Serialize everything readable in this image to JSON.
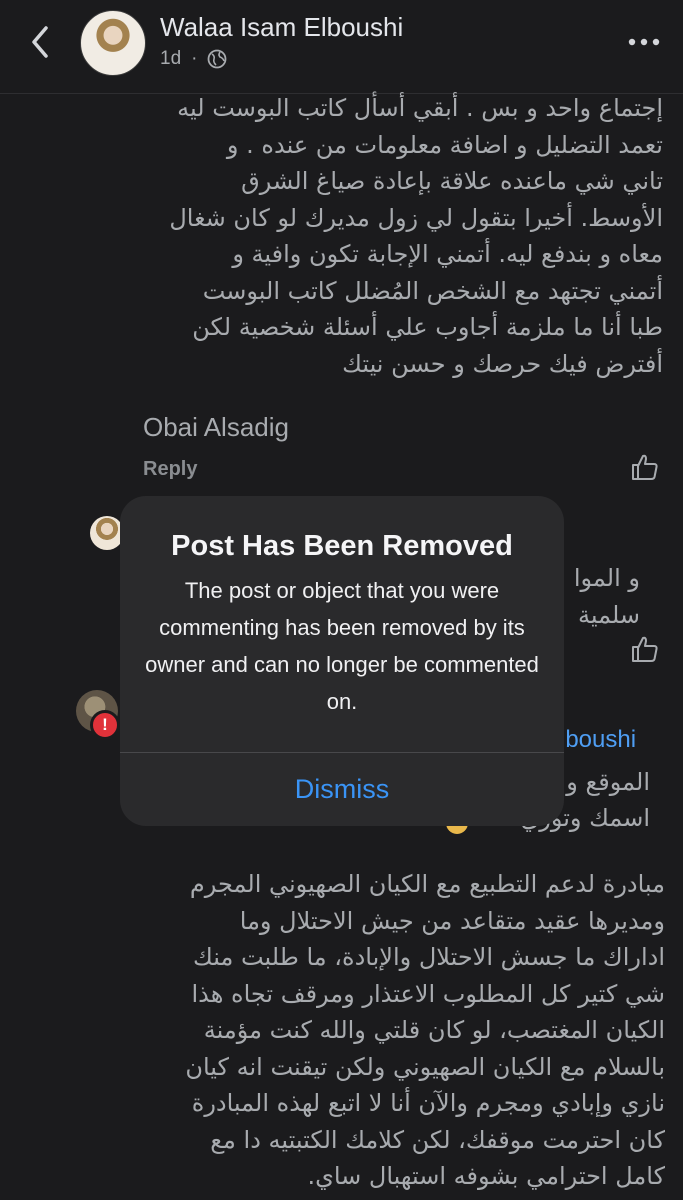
{
  "header": {
    "author": "Walaa Isam Elboushi",
    "time": "1d",
    "separator": "·"
  },
  "comment_block_1": [
    "إجتماع واحد و بس . أبقي أسأل كاتب البوست ليه",
    "تعمد التضليل و اضافة معلومات من عنده . و",
    "تاني شي ماعنده علاقة بإعادة صياغ الشرق",
    "الأوسط. أخيرا بتقول لي زول مديرك لو كان شغال",
    "معاه و بندفع ليه. أتمني الإجابة تكون وافية و",
    "أتمني تجتهد مع الشخص المُضلل كاتب البوست",
    "طبا أنا ما ملزمة أجاوب علي أسئلة شخصية لكن",
    "أفترض فيك حرصك و حسن نيتك"
  ],
  "commenter": "Obai Alsadig",
  "reply_label": "Reply",
  "partial_text_1a": "و الموا",
  "partial_text_1b": "سلمية",
  "partial_name": "lboushi",
  "partial_text_2a": "الموقع و",
  "partial_text_2b": "اسمك وتوري",
  "badge": "!",
  "comment_block_2": [
    "مبادرة لدعم التطبيع مع الكيان الصهيوني المجرم",
    "ومديرها عقيد متقاعد من جيش الاحتلال وما",
    "اداراك ما جسش الاحتلال والإبادة، ما طلبت منك",
    "شي كتير كل المطلوب الاعتذار ومرقف تجاه هذا",
    "الكيان المغتصب، لو كان قلتي والله كنت مؤمنة",
    "بالسلام مع الكيان الصهيوني ولكن تيقنت انه كيان",
    "نازي وإبادي ومجرم والآن أنا لا اتبع لهذه المبادرة",
    "كان احترمت موقفك، لكن كلامك الكتبتيه دا مع",
    "كامل احترامي بشوفه استهبال ساي."
  ],
  "dialog": {
    "title": "Post Has Been Removed",
    "message": "The post or object that you were commenting has been removed by its owner and can no longer be commented on.",
    "button": "Dismiss"
  },
  "icons": {
    "back": "chevron-left-icon",
    "privacy": "globe-icon",
    "more": "more-dots-icon",
    "like": "thumbs-up-icon"
  },
  "colors": {
    "background": "#1b1b1d",
    "dialog": "#2a2a2c",
    "link": "#4f9ef3",
    "button": "#3a94f6",
    "alert": "#e0323a"
  }
}
